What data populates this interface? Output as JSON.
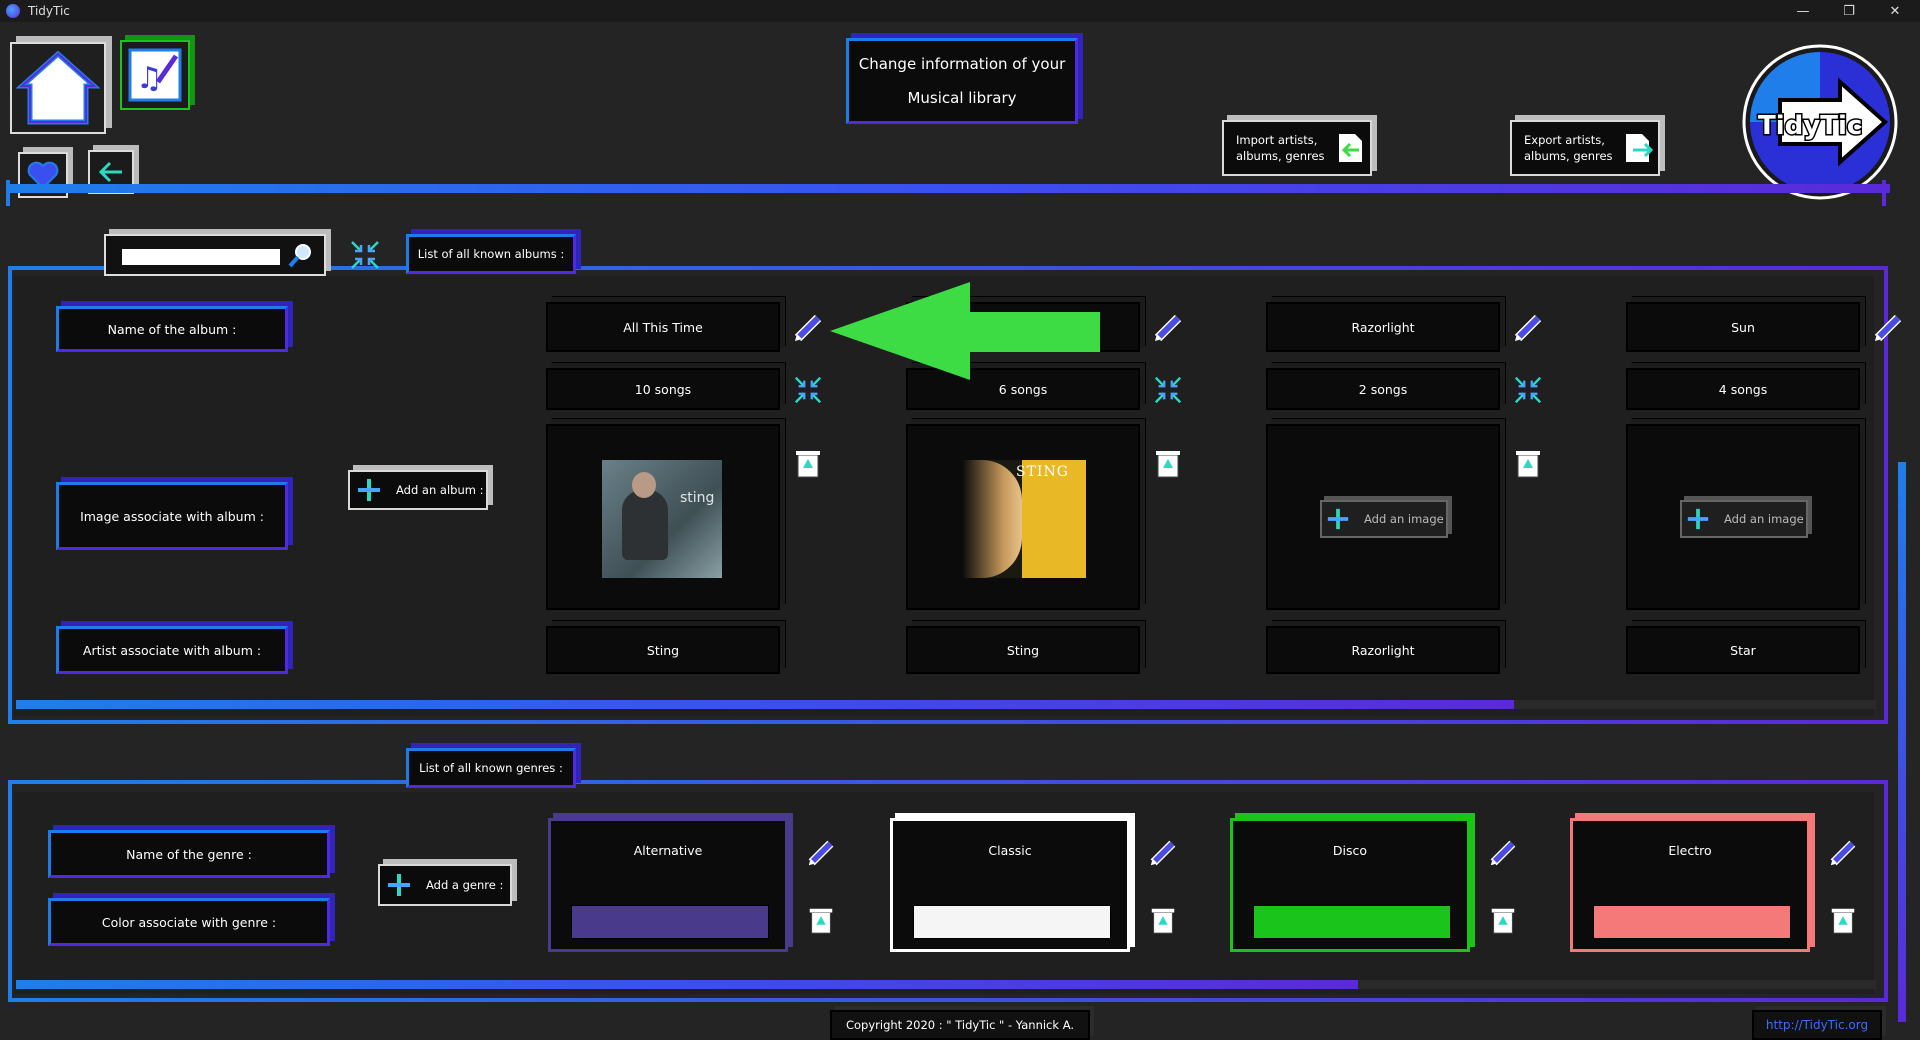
{
  "window": {
    "title": "TidyTic",
    "min": "—",
    "restore": "❐",
    "close": "✕"
  },
  "header": {
    "title_line1": "Change information of your",
    "title_line2": "Musical library",
    "import_label_1": "Import artists,",
    "import_label_2": "albums, genres",
    "export_label_1": "Export artists,",
    "export_label_2": "albums, genres",
    "logo_text": "TidyTic"
  },
  "albums_section": {
    "tab_label": "List of all known albums :",
    "search_placeholder": "",
    "row_labels": {
      "name": "Name of the album :",
      "image": "Image associate with album :",
      "artist": "Artist associate with album :"
    },
    "add_button": "Add an album :",
    "add_image_label": "Add an image",
    "albums": [
      {
        "name": "All This Time",
        "songs": "10 songs",
        "artist": "Sting",
        "has_image": true
      },
      {
        "name": "",
        "songs": "6 songs",
        "artist": "Sting",
        "has_image": true
      },
      {
        "name": "Razorlight",
        "songs": "2 songs",
        "artist": "Razorlight",
        "has_image": false
      },
      {
        "name": "Sun",
        "songs": "4 songs",
        "artist": "Star",
        "has_image": false
      }
    ],
    "album2_cover_text": "STING",
    "album1_cover_text": "sting"
  },
  "genres_section": {
    "tab_label": "List of all known genres :",
    "row_labels": {
      "name": "Name of the genre :",
      "color": "Color associate with genre :"
    },
    "add_button": "Add a genre :",
    "genres": [
      {
        "name": "Alternative",
        "color": "#4a3a8c",
        "border": "#4a3a8c"
      },
      {
        "name": "Classic",
        "color": "#f5f5f5",
        "border": "#ffffff"
      },
      {
        "name": "Disco",
        "color": "#1bc41b",
        "border": "#1bc41b"
      },
      {
        "name": "Electro",
        "color": "#f47a7a",
        "border": "#f47a7a"
      }
    ]
  },
  "footer": {
    "copyright": "Copyright 2020 : \" TidyTic \" - Yannick A.",
    "link": "http://TidyTic.org"
  },
  "colors": {
    "accent_blue": "#1f7eea",
    "accent_purple": "#5a2ad8",
    "arrow_green": "#3ddc44"
  }
}
